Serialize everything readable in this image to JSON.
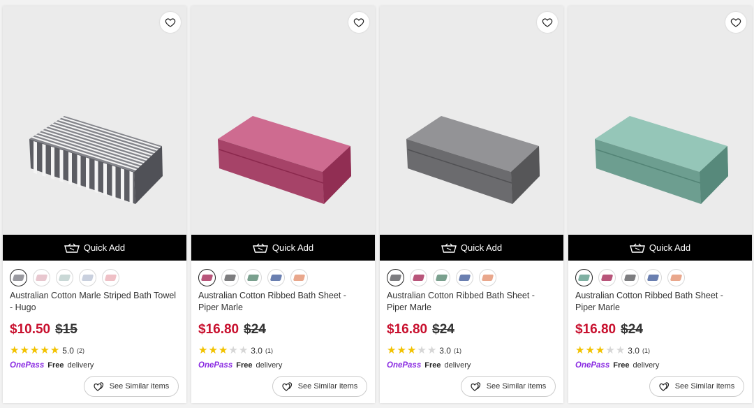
{
  "colors": {
    "price_red": "#c8102e",
    "onepass_purple": "#8a2be2",
    "star_yellow": "#f2c200",
    "quick_add_bg": "#000000"
  },
  "products": [
    {
      "image_icon": "striped-towel-image",
      "towel_color": "#6e6f75",
      "towel_style": "striped",
      "quick_add_label": "Quick Add",
      "swatches": [
        "#9a9aa0",
        "#e8c7cf",
        "#c9d8d6",
        "#c9d0de",
        "#efc0c6"
      ],
      "selected_swatch": 0,
      "title": "Australian Cotton Marle Striped Bath Towel - Hugo",
      "price": "$10.50",
      "was_price": "$15",
      "rating_stars": 5,
      "rating_value": "5.0",
      "rating_count": "(2)",
      "onepass_label": "OnePass",
      "free_label": "Free",
      "delivery_label": "delivery",
      "similar_label": "See Similar items"
    },
    {
      "image_icon": "pink-towel-image",
      "towel_color": "#b8557a",
      "towel_style": "plain",
      "quick_add_label": "Quick Add",
      "swatches": [
        "#b8557a",
        "#7d7d7f",
        "#7aa08e",
        "#6a7fb0",
        "#e9a78c"
      ],
      "selected_swatch": 0,
      "title": "Australian Cotton Ribbed Bath Sheet - Piper Marle",
      "price": "$16.80",
      "was_price": "$24",
      "rating_stars": 3,
      "rating_value": "3.0",
      "rating_count": "(1)",
      "onepass_label": "OnePass",
      "free_label": "Free",
      "delivery_label": "delivery",
      "similar_label": "See Similar items"
    },
    {
      "image_icon": "grey-towel-image",
      "towel_color": "#7d7d80",
      "towel_style": "plain",
      "quick_add_label": "Quick Add",
      "swatches": [
        "#7d7d80",
        "#b8557a",
        "#7aa08e",
        "#6a7fb0",
        "#e9a78c"
      ],
      "selected_swatch": 0,
      "title": "Australian Cotton Ribbed Bath Sheet - Piper Marle",
      "price": "$16.80",
      "was_price": "$24",
      "rating_stars": 3,
      "rating_value": "3.0",
      "rating_count": "(1)",
      "onepass_label": "OnePass",
      "free_label": "Free",
      "delivery_label": "delivery",
      "similar_label": "See Similar items"
    },
    {
      "image_icon": "sage-towel-image",
      "towel_color": "#7fb0a2",
      "towel_style": "plain",
      "quick_add_label": "Quick Add",
      "swatches": [
        "#7fb0a2",
        "#b8557a",
        "#7d7d80",
        "#6a7fb0",
        "#e9a78c"
      ],
      "selected_swatch": 0,
      "title": "Australian Cotton Ribbed Bath Sheet - Piper Marle",
      "price": "$16.80",
      "was_price": "$24",
      "rating_stars": 3,
      "rating_value": "3.0",
      "rating_count": "(1)",
      "onepass_label": "OnePass",
      "free_label": "Free",
      "delivery_label": "delivery",
      "similar_label": "See Similar items"
    }
  ]
}
